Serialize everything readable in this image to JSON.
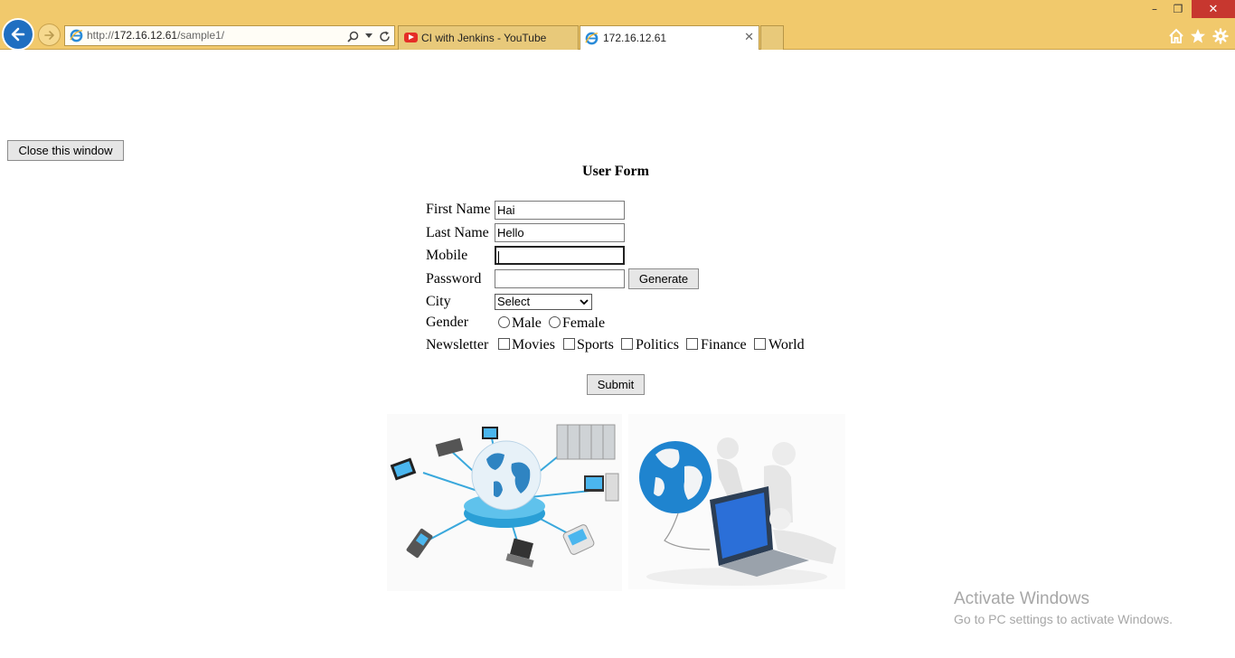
{
  "browser": {
    "address_prefix": "http://",
    "address_host": "172.16.12.61",
    "address_path": "/sample1/",
    "tabs": [
      {
        "title": "CI with Jenkins - YouTube",
        "icon": "youtube-icon"
      },
      {
        "title": "172.16.12.61",
        "icon": "ie-page-icon",
        "active": true
      }
    ],
    "window_controls": {
      "minimize": "–",
      "restore": "❐",
      "close": "✕"
    },
    "tab_close": "✕",
    "accent_color": "#f1c96c"
  },
  "page": {
    "close_button": "Close this window",
    "form_title": "User Form",
    "first_name_label": "First Name",
    "first_name_value": "Hai",
    "last_name_label": "Last Name",
    "last_name_value": "Hello",
    "mobile_label": "Mobile",
    "mobile_value": "",
    "password_label": "Password",
    "password_value": "",
    "generate_button": "Generate",
    "city_label": "City",
    "city_selected": "Select",
    "gender_label": "Gender",
    "gender_options": [
      "Male",
      "Female"
    ],
    "newsletter_label": "Newsletter",
    "newsletter_options": [
      "Movies",
      "Sports",
      "Politics",
      "Finance",
      "World"
    ],
    "submit_button": "Submit"
  },
  "watermark": {
    "title": "Activate Windows",
    "subtitle": "Go to PC settings to activate Windows."
  }
}
